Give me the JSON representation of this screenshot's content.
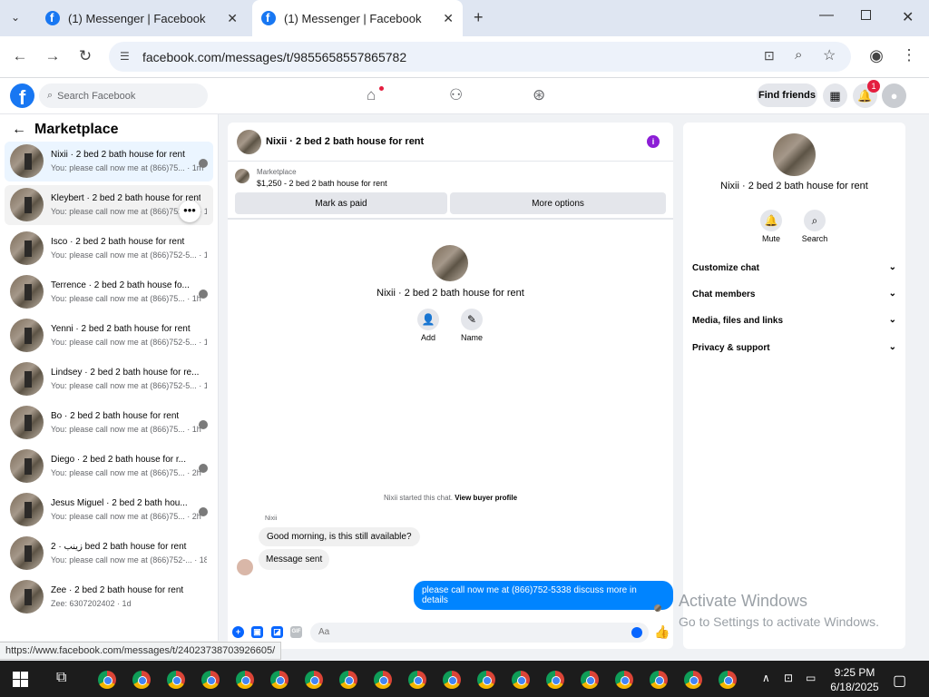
{
  "browser": {
    "tabs": [
      {
        "title": "(1) Messenger | Facebook"
      },
      {
        "title": "(1) Messenger | Facebook"
      }
    ],
    "url": "facebook.com/messages/t/9855658557865782",
    "status_url": "https://www.facebook.com/messages/t/24023738703926605/"
  },
  "header": {
    "search_placeholder": "Search Facebook",
    "find_friends": "Find friends",
    "notification_count": "1"
  },
  "sidebar": {
    "title": "Marketplace",
    "conversations": [
      {
        "name": "Nixii · 2 bed 2 bath house for rent",
        "preview": "You: please call now me at (866)75... · 1m"
      },
      {
        "name": "Kleybert · 2 bed 2 bath house for rent",
        "preview": "You: please call now me at (866)752-5... · 1h"
      },
      {
        "name": "Isco · 2 bed 2 bath house for rent",
        "preview": "You: please call now me at (866)752-5... · 1h"
      },
      {
        "name": "Terrence · 2 bed 2 bath house fo...",
        "preview": "You: please call now me at (866)75... · 1h"
      },
      {
        "name": "Yenni · 2 bed 2 bath house for rent",
        "preview": "You: please call now me at (866)752-5... · 1h"
      },
      {
        "name": "Lindsey · 2 bed 2 bath house for re...",
        "preview": "You: please call now me at (866)752-5... · 1h"
      },
      {
        "name": "Bo · 2 bed 2 bath house for rent",
        "preview": "You: please call now me at (866)75... · 1h"
      },
      {
        "name": "Diego · 2 bed 2 bath house for r...",
        "preview": "You: please call now me at (866)75... · 2h"
      },
      {
        "name": "Jesus Miguel · 2 bed 2 bath hou...",
        "preview": "You: please call now me at (866)75... · 2h"
      },
      {
        "name": "زينب · 2 bed 2 bath house for rent",
        "preview": "You: please call now me at (866)752-... · 18h"
      },
      {
        "name": "Zee · 2 bed 2 bath house for rent",
        "preview": "Zee: 6307202402 · 1d"
      }
    ]
  },
  "chat": {
    "title": "Nixii · 2 bed 2 bath house for rent",
    "marketplace_label": "Marketplace",
    "listing": "$1,250 - 2 bed 2 bath house for rent",
    "mark_paid": "Mark as paid",
    "more_options": "More options",
    "center_name": "Nixii · 2 bed 2 bath house for rent",
    "add_label": "Add",
    "name_label": "Name",
    "started_text": "Nixii started this chat.",
    "view_profile": "View buyer profile",
    "sender": "Nixii",
    "messages": [
      {
        "text": "Good morning, is this still available?"
      },
      {
        "text": "Message sent"
      },
      {
        "text": "please call now me at (866)752-5338 discuss more in details"
      }
    ],
    "input_placeholder": "Aa"
  },
  "right_panel": {
    "name": "Nixii · 2 bed 2 bath house for rent",
    "mute": "Mute",
    "search": "Search",
    "sections": [
      "Customize chat",
      "Chat members",
      "Media, files and links",
      "Privacy & support"
    ]
  },
  "watermark": {
    "line1": "Activate Windows",
    "line2": "Go to Settings to activate Windows."
  },
  "taskbar": {
    "time": "9:25 PM",
    "date": "6/18/2025"
  }
}
